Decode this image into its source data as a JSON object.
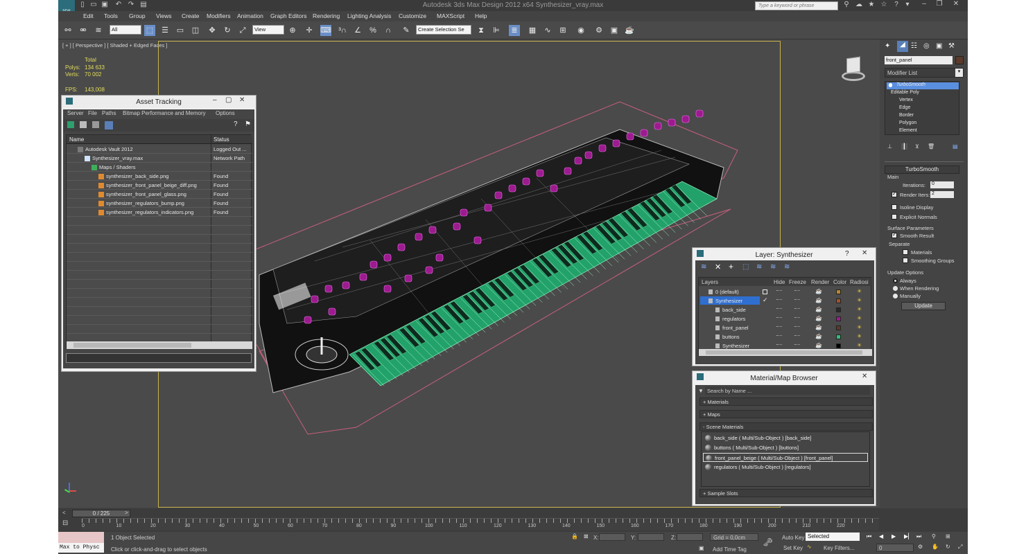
{
  "app": {
    "title": "Autodesk 3ds Max Design 2012 x64      Synthesizer_vray.max",
    "logo_text": "3DS",
    "search_placeholder": "Type a keyword or phrase"
  },
  "menus": [
    "Edit",
    "Tools",
    "Group",
    "Views",
    "Create",
    "Modifiers",
    "Animation",
    "Graph Editors",
    "Rendering",
    "Lighting Analysis",
    "Customize",
    "MAXScript",
    "Help"
  ],
  "toolbar": {
    "selection_filter": "All",
    "ref_coord": "View",
    "selection_set": "Create Selection Se"
  },
  "viewport": {
    "label": "[ + ] [ Perspective ] [ Shaded + Edged Faces ]",
    "stats_header": "Total",
    "polys_label": "Polys:",
    "polys_value": "134 633",
    "verts_label": "Verts:",
    "verts_value": "70 002",
    "fps_label": "FPS:",
    "fps_value": "143,008"
  },
  "asset_tracking": {
    "title": "Asset Tracking",
    "menu": [
      "Server",
      "File",
      "Paths",
      "Bitmap Performance and Memory",
      "Options"
    ],
    "col_name": "Name",
    "col_status": "Status",
    "rows": [
      {
        "name": "Autodesk Vault 2012",
        "status": "Logged Out ..."
      },
      {
        "name": "Synthesizer_vray.max",
        "status": "Network Path"
      },
      {
        "name": "Maps / Shaders",
        "status": ""
      },
      {
        "name": "synthesizer_back_side.png",
        "status": "Found"
      },
      {
        "name": "synthesizer_front_panel_beige_diff.png",
        "status": "Found"
      },
      {
        "name": "synthesizer_front_panel_glass.png",
        "status": "Found"
      },
      {
        "name": "synthesizer_regulators_bump.png",
        "status": "Found"
      },
      {
        "name": "synthesizer_regulators_indicators.png",
        "status": "Found"
      }
    ]
  },
  "layer_window": {
    "title": "Layer: Synthesizer",
    "help": "?",
    "cols": [
      "Layers",
      "Hide",
      "Freeze",
      "Render",
      "Color",
      "Radiosi"
    ],
    "rows": [
      {
        "name": "0 (default)",
        "color": "#b8862a"
      },
      {
        "name": "Synthesizer",
        "color": "#a0522d"
      },
      {
        "name": "back_side",
        "color": "#2a2a2a"
      },
      {
        "name": "regulators",
        "color": "#9c1b8e"
      },
      {
        "name": "front_panel",
        "color": "#5a3a2a"
      },
      {
        "name": "buttons",
        "color": "#2fbf7a"
      },
      {
        "name": "Synthesizer",
        "color": "#000000"
      }
    ]
  },
  "material_browser": {
    "title": "Material/Map Browser",
    "search_placeholder": "Search by Name ...",
    "sections": [
      "+ Materials",
      "+ Maps",
      "- Scene Materials",
      "+ Sample Slots"
    ],
    "materials": [
      "back_side  ( Multi/Sub-Object ) [back_side]",
      "buttons  ( Multi/Sub-Object ) [buttons]",
      "front_panel_beige  ( Multi/Sub-Object ) [front_panel]",
      "regulators  ( Multi/Sub-Object ) [regulators]"
    ]
  },
  "command_panel": {
    "object_name": "front_panel",
    "modifier_list": "Modifier List",
    "stack": [
      "TurboSmooth",
      "Editable Poly",
      "Vertex",
      "Edge",
      "Border",
      "Polygon",
      "Element"
    ],
    "rollout_title": "TurboSmooth",
    "main_label": "Main",
    "iterations_label": "Iterations:",
    "iterations_value": "0",
    "render_iters_label": "Render Iters:",
    "render_iters_value": "2",
    "isoline": "Isoline Display",
    "explicit_normals": "Explicit Normals",
    "surface_params": "Surface Parameters",
    "smooth_result": "Smooth Result",
    "separate": "Separate",
    "materials": "Materials",
    "smoothing_groups": "Smoothing Groups",
    "update_options": "Update Options",
    "always": "Always",
    "when_rendering": "When Rendering",
    "manually": "Manually",
    "update_button": "Update"
  },
  "timeline": {
    "frame": "0 / 225",
    "ticks": [
      "0",
      "10",
      "20",
      "30",
      "40",
      "50",
      "60",
      "70",
      "80",
      "90",
      "100",
      "110",
      "120",
      "130",
      "140",
      "150",
      "160",
      "170",
      "180",
      "190",
      "200",
      "210",
      "220"
    ]
  },
  "status": {
    "maxscript": "Max to Physc",
    "selected": "1 Object Selected",
    "prompt": "Click or click-and-drag to select objects",
    "x_label": "X:",
    "y_label": "Y:",
    "z_label": "Z:",
    "grid": "Grid = 0,0cm",
    "add_time_tag": "Add Time Tag",
    "auto_key": "Auto Key",
    "set_key": "Set Key",
    "key_mode": "Selected",
    "key_filters": "Key Filters...",
    "frame_field": "0"
  }
}
